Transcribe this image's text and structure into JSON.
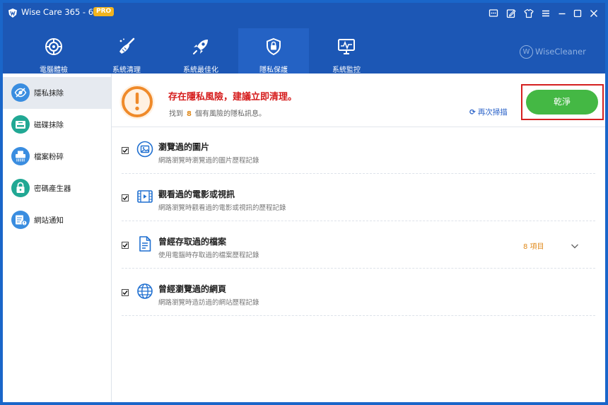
{
  "window": {
    "title": "Wise Care 365 - 6.3.2",
    "badge": "PRO"
  },
  "titlebar": {
    "icons": [
      "feedback-icon",
      "edit-icon",
      "skin-icon",
      "menu-icon",
      "minimize-icon",
      "maximize-icon",
      "close-icon"
    ]
  },
  "nav": {
    "tabs": [
      {
        "label": "電腦體檢",
        "icon": "radar-icon"
      },
      {
        "label": "系統清理",
        "icon": "broom-icon"
      },
      {
        "label": "系統最佳化",
        "icon": "rocket-icon"
      },
      {
        "label": "隱私保護",
        "icon": "shield-lock-icon"
      },
      {
        "label": "系統監控",
        "icon": "monitor-icon"
      }
    ],
    "active": "隱私保護",
    "brand": "WiseCleaner"
  },
  "sidebar": {
    "items": [
      {
        "label": "隱私抹除",
        "icon": "eye-slash-icon"
      },
      {
        "label": "磁碟抹除",
        "icon": "disk-eraser-icon"
      },
      {
        "label": "檔案粉碎",
        "icon": "shredder-icon"
      },
      {
        "label": "密碼產生器",
        "icon": "password-icon"
      },
      {
        "label": "網站通知",
        "icon": "notification-icon"
      }
    ],
    "active": "隱私抹除"
  },
  "alert": {
    "title": "存在隱私風險，建議立即清理。",
    "prefix": "找到",
    "count": "8",
    "suffix": "個有風險的隱私訊息。",
    "rescan_label": "再次掃描",
    "clean_label": "乾淨"
  },
  "items": [
    {
      "title": "瀏覽過的圖片",
      "desc": "網路瀏覽時瀏覽過的圖片歷程記錄",
      "checked": true,
      "icon": "image-icon",
      "count": ""
    },
    {
      "title": "觀看過的電影或視訊",
      "desc": "網路瀏覽時觀看過的電影或視訊的歷程記錄",
      "checked": true,
      "icon": "video-icon",
      "count": ""
    },
    {
      "title": "曾經存取過的檔案",
      "desc": "使用電腦時存取過的檔案歷程記錄",
      "checked": true,
      "icon": "document-icon",
      "count": "8 項目"
    },
    {
      "title": "曾經瀏覽過的網頁",
      "desc": "網路瀏覽時造訪過的網站歷程記錄",
      "checked": true,
      "icon": "globe-icon",
      "count": ""
    }
  ],
  "colors": {
    "header": "#1c57b5",
    "accent_green": "#44b844",
    "warning_orange": "#ef8a2a",
    "danger_red": "#d51b1b",
    "icon_blue": "#1f6fd0"
  }
}
